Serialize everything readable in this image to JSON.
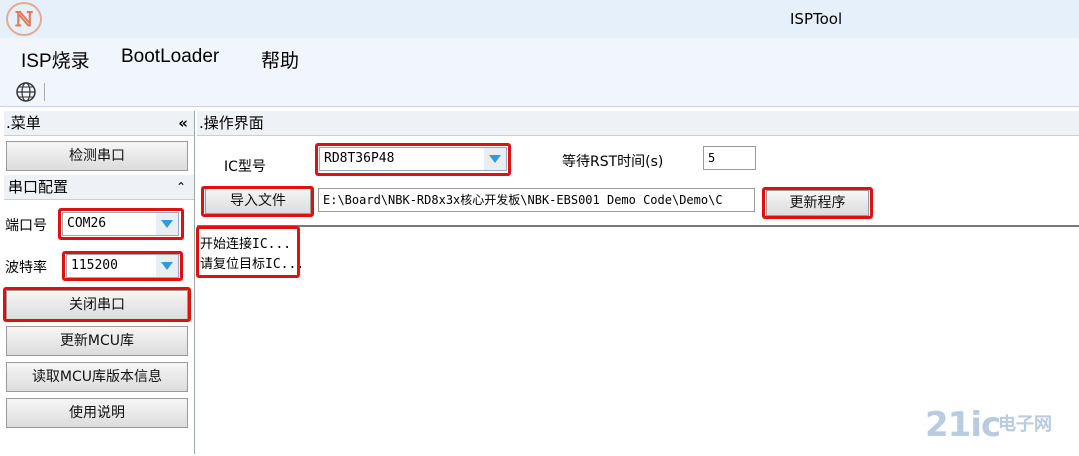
{
  "window": {
    "title": "ISPTool",
    "logo_text": "ℕ"
  },
  "menu": {
    "items": [
      "ISP烧录",
      "BootLoader",
      "帮助"
    ]
  },
  "left_panel": {
    "header": ".菜单",
    "collapse_glyph": "«",
    "detect_button": "检测串口",
    "serial_section": {
      "title": "串口配置",
      "collapse_glyph": "⌃",
      "port_label": "端口号",
      "port_value": "COM26",
      "baud_label": "波特率",
      "baud_value": "115200"
    },
    "close_port_button": "关闭串口",
    "update_mcu_button": "更新MCU库",
    "read_mcu_button": "读取MCU库版本信息",
    "help_button": "使用说明"
  },
  "right_panel": {
    "header": ".操作界面",
    "ic_label": "IC型号",
    "ic_value": "RD8T36P48",
    "wait_label": "等待RST时间(s)",
    "wait_value": "5",
    "import_button": "导入文件",
    "file_path": "E:\\Board\\NBK-RD8x3x核心开发板\\NBK-EBS001 Demo Code\\Demo\\C",
    "update_button": "更新程序",
    "log_lines": [
      "开始连接IC...",
      "请复位目标IC..."
    ]
  },
  "watermark": {
    "text": "21ic",
    "sub": "电子网"
  },
  "colors": {
    "highlight": "#e01010",
    "accent": "#3399dd"
  }
}
